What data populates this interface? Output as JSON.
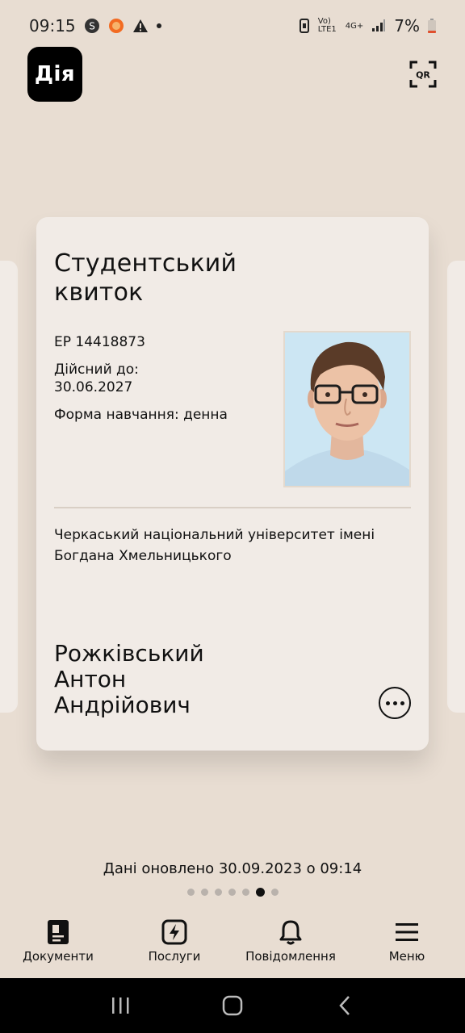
{
  "status_bar": {
    "time": "09:15",
    "network": "Vo) LTE1",
    "network_type": "4G+",
    "battery": "7%",
    "icons": [
      "s-app-icon",
      "orange-app-icon",
      "warning-icon",
      "notification-dot",
      "vibrate-icon",
      "signal-icon",
      "battery-icon"
    ]
  },
  "header": {
    "logo": "Дія",
    "qr_label": "QR"
  },
  "card": {
    "title": "Студентський квиток",
    "number": "ЕР 14418873",
    "valid_until_label": "Дійсний до:",
    "valid_until": "30.06.2027",
    "study_form": "Форма навчання: денна",
    "university": "Черкаський національний університет імені Богдана Хмельницького",
    "name_last": "Рожківський",
    "name_first": "Антон",
    "name_middle": "Андрійович"
  },
  "footer": {
    "updated": "Дані оновлено 30.09.2023 о 09:14",
    "pager_total": 7,
    "pager_active": 6
  },
  "tabs": [
    {
      "label": "Документи",
      "icon": "document-icon"
    },
    {
      "label": "Послуги",
      "icon": "lightning-icon"
    },
    {
      "label": "Повідомлення",
      "icon": "bell-icon"
    },
    {
      "label": "Меню",
      "icon": "menu-icon"
    }
  ],
  "colors": {
    "background": "#e8ddd2",
    "card": "#f1ebe6",
    "text": "#111111",
    "nav_bar": "#000000"
  }
}
